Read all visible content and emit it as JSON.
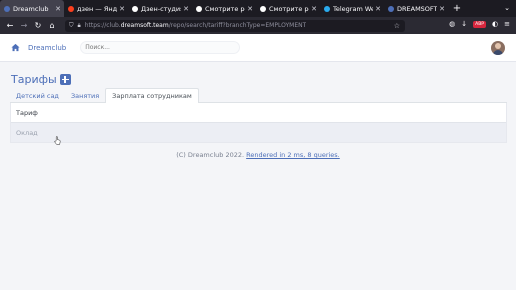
{
  "browser": {
    "tabs": [
      {
        "title": "Dreamclub",
        "favicon_color": "#4d6fb8",
        "active": true
      },
      {
        "title": "дзен — Яндекс",
        "favicon_color": "#fc3f1d",
        "active": false
      },
      {
        "title": "Дзен-студия |",
        "favicon_color": "#ffffff",
        "active": false
      },
      {
        "title": "Смотрите рол",
        "favicon_color": "#ffffff",
        "active": false
      },
      {
        "title": "Смотрите рол",
        "favicon_color": "#ffffff",
        "active": false
      },
      {
        "title": "Telegram Web",
        "favicon_color": "#2aabee",
        "active": false
      },
      {
        "title": "DREAMSOFT | П",
        "favicon_color": "#4d6fb8",
        "active": false
      }
    ],
    "url_prefix": "https://club.",
    "url_domain": "dreamsoft.team",
    "url_path": "/repo/search/tariff?branchType=EMPLOYMENT"
  },
  "header": {
    "brand": "Dreamclub",
    "search_placeholder": "Поиск..."
  },
  "page": {
    "title": "Тарифы",
    "tabs": [
      {
        "label": "Детский сад",
        "active": false
      },
      {
        "label": "Занятия",
        "active": false
      },
      {
        "label": "Зарплата сотрудникам",
        "active": true
      }
    ],
    "table": {
      "header": "Тариф",
      "rows": [
        "Оклад"
      ]
    }
  },
  "footer": {
    "copyright": "(C) Dreamclub 2022.",
    "render_link": "Rendered in 2 ms, 8 queries."
  },
  "colors": {
    "accent": "#4d6fb8",
    "tab_bar": "#1c1b22",
    "toolbar": "#2b2a33"
  }
}
